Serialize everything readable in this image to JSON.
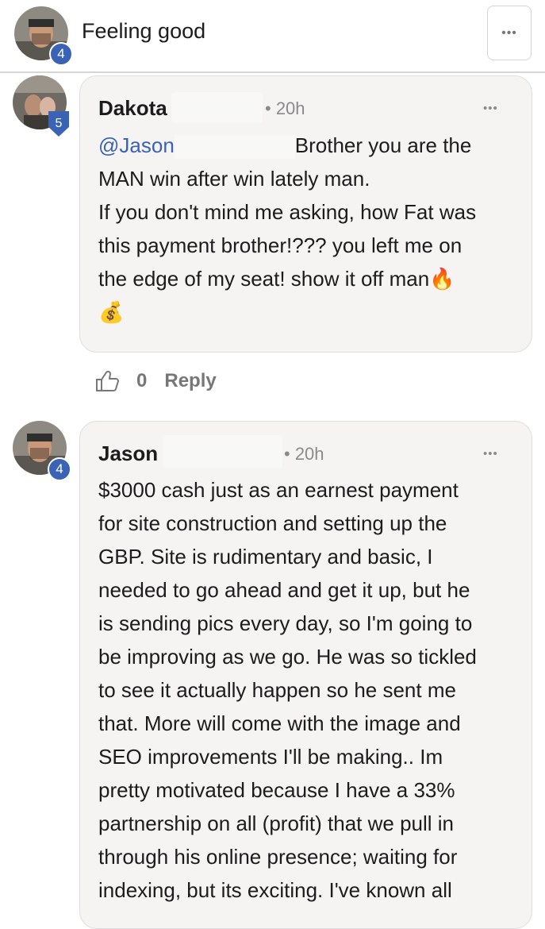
{
  "header": {
    "title": "Feeling good",
    "more_label": "•••",
    "author_level": "4"
  },
  "comments": [
    {
      "author": "Dakota",
      "time": "• 20h",
      "level": "5",
      "more_label": "•••",
      "mention": "@Jason",
      "lines": [
        "Brother you are the",
        "MAN win after win lately man.",
        "If you don't mind me asking, how Fat was",
        "this payment brother!??? you left me on",
        "the edge of my seat! show it off man"
      ],
      "emoji_fire": "🔥",
      "emoji_money": "💰",
      "likes": "0",
      "reply_label": "Reply"
    },
    {
      "author": "Jason",
      "time": "• 20h",
      "level": "4",
      "more_label": "•••",
      "lines": [
        "$3000 cash just as an earnest payment",
        "for site construction and setting up the",
        "GBP. Site is rudimentary and basic, I",
        "needed to go ahead and get it up, but he",
        "is sending pics every day, so I'm going to",
        "be improving as we go. He was so tickled",
        "to see it actually happen so he sent me",
        "that. More will come with the image and",
        "SEO improvements I'll be making.. Im",
        "pretty motivated because I have a 33%",
        "partnership on all (profit) that we pull in",
        "through his online presence; waiting for",
        "indexing, but its exciting. I've known all"
      ]
    }
  ],
  "colors": {
    "accent": "#3b63b5",
    "bubble_bg": "#f5f4f2",
    "muted": "#8a8a8a"
  },
  "icons": [
    "thumbs-up-icon",
    "more-options-icon",
    "fire-emoji",
    "money-bag-emoji"
  ]
}
